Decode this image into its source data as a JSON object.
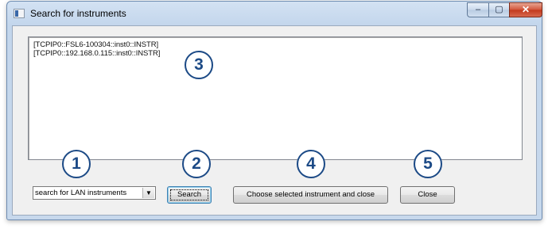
{
  "window": {
    "title": "Search for instruments",
    "controls": {
      "minimize": "–",
      "maximize": "▢",
      "close": "✕"
    }
  },
  "instrument_list": {
    "items": [
      "[TCPIP0::FSL6-100304::inst0::INSTR]",
      "[TCPIP0::192.168.0.115::inst0::INSTR]"
    ]
  },
  "search_type": {
    "selected": "search for LAN instruments",
    "arrow": "▼"
  },
  "buttons": {
    "search": "Search",
    "choose": "Choose selected instrument and close",
    "close": "Close"
  },
  "callouts": [
    "1",
    "2",
    "3",
    "4",
    "5"
  ]
}
